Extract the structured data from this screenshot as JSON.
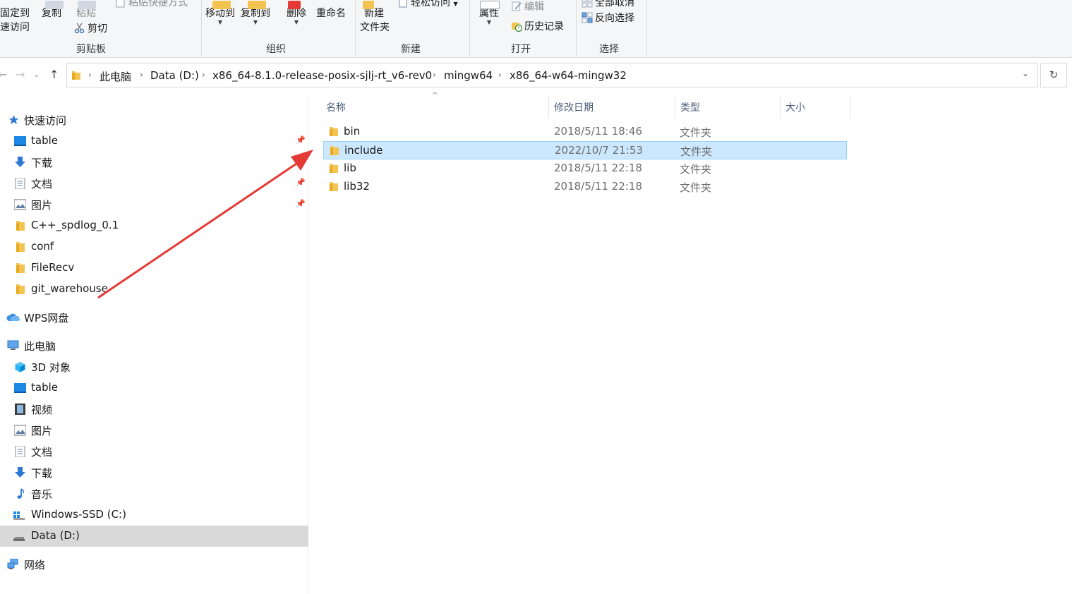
{
  "ribbon": {
    "clipboard": {
      "pin_label_1": "固定到",
      "pin_label_2": "速访问",
      "copy": "复制",
      "paste": "粘贴",
      "paste_shortcut": "粘贴快捷方式",
      "cut": "剪切",
      "group": "剪贴板"
    },
    "organize": {
      "move_to": "移动到",
      "copy_to": "复制到",
      "delete": "删除",
      "rename": "重命名",
      "group": "组织"
    },
    "new": {
      "new_folder_1": "新建",
      "new_folder_2": "文件夹",
      "easy_access": "轻松访问",
      "group": "新建"
    },
    "open": {
      "properties": "属性",
      "edit": "编辑",
      "history": "历史记录",
      "group": "打开"
    },
    "select": {
      "select_none": "全部取消",
      "invert_selection": "反向选择",
      "group": "选择"
    }
  },
  "address": {
    "crumbs": [
      "此电脑",
      "Data (D:)",
      "x86_64-8.1.0-release-posix-sjlj-rt_v6-rev0",
      "mingw64",
      "x86_64-w64-mingw32"
    ]
  },
  "nav": {
    "quick_access": "快速访问",
    "quick_items": [
      "table",
      "下载",
      "文档",
      "图片",
      "C++_spdlog_0.1",
      "conf",
      "FileRecv",
      "git_warehouse"
    ],
    "wps": "WPS网盘",
    "this_pc": "此电脑",
    "pc_items": [
      "3D 对象",
      "table",
      "视频",
      "图片",
      "文档",
      "下载",
      "音乐",
      "Windows-SSD (C:)",
      "Data (D:)"
    ],
    "network": "网络"
  },
  "columns": {
    "name": "名称",
    "date": "修改日期",
    "type": "类型",
    "size": "大小"
  },
  "files": [
    {
      "name": "bin",
      "date": "2018/5/11 18:46",
      "type": "文件夹"
    },
    {
      "name": "include",
      "date": "2022/10/7 21:53",
      "type": "文件夹"
    },
    {
      "name": "lib",
      "date": "2018/5/11 22:18",
      "type": "文件夹"
    },
    {
      "name": "lib32",
      "date": "2018/5/11 22:18",
      "type": "文件夹"
    }
  ],
  "colors": {
    "selection": "#cce8ff",
    "selection_border": "#99d1ff",
    "folder": "#f3c451",
    "annotation_arrow": "#e53935"
  }
}
